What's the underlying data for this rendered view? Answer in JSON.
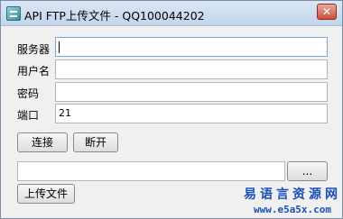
{
  "window": {
    "title": "API FTP上传文件 - QQ100044202",
    "close_label": "✕"
  },
  "form": {
    "server": {
      "label": "服务器",
      "value": ""
    },
    "username": {
      "label": "用户名",
      "value": ""
    },
    "password": {
      "label": "密码",
      "value": ""
    },
    "port": {
      "label": "端口",
      "value": "21"
    }
  },
  "buttons": {
    "connect": "连接",
    "disconnect": "断开",
    "browse": "...",
    "upload": "上传文件"
  },
  "file_path": {
    "value": ""
  },
  "watermark": {
    "chinese": "易语言资源网",
    "url": "www.e5a5x.com"
  }
}
